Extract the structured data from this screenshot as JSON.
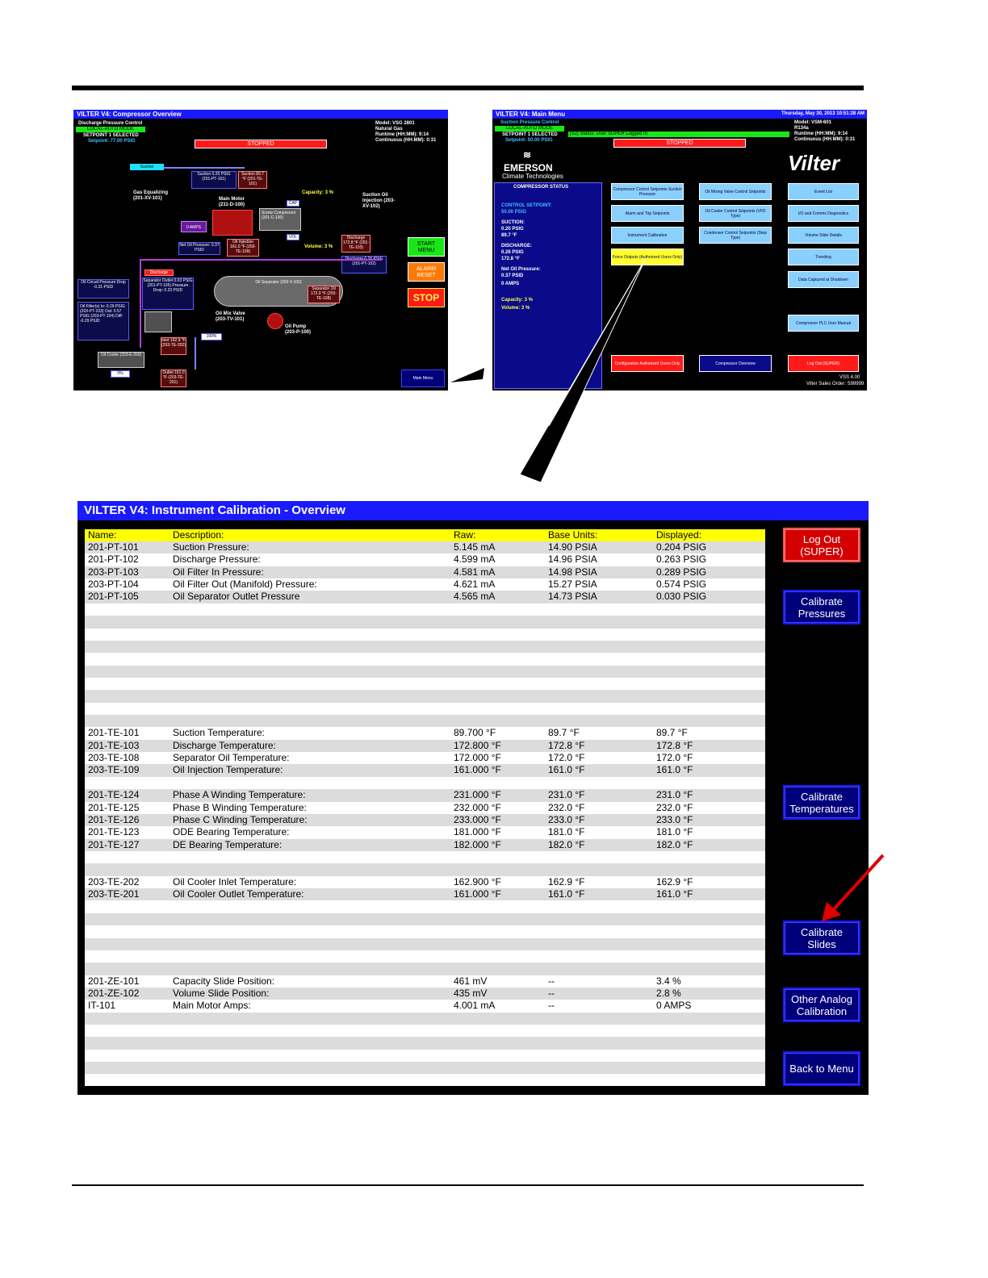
{
  "overview": {
    "title": "VILTER V4: Compressor Overview",
    "mode_title": "Discharge Pressure Control",
    "mode": "LOCAL-AUTO MODE",
    "setpoint_sel": "SETPOINT 1 SELECTED",
    "setpoint": "Setpoint: 77.00 PSIG",
    "model": "Model: VSG 2801",
    "refrigerant": "Natural Gas",
    "runtime": "Runtime (HH:MM): 9:14",
    "continuous": "Continuous (HH:MM): 0:31",
    "status": "STOPPED",
    "suction_label": "Suction",
    "suction_pressure": "Suction 0.20 PSIG (201-PT-101)",
    "suction_temp": "Suction 89.7 °F (201-TE-101)",
    "gas_equalizing": "Gas Equalizing (201-XV-101)",
    "main_motor": "Main Motor (211-D-100)",
    "amps": "0 AMPS",
    "capacity": "Capacity: 3 %",
    "volume": "Volume: 3 %",
    "screw_compressor": "Screw Compressor (201-C-100)",
    "cap": "CAP",
    "vol": "VOL",
    "suction_oil_injection": "Suction Oil Injection (203-XV-102)",
    "net_oil": "Net Oil Pressure: 0.37 PSID",
    "oil_injection": "Oil Injection 161.0 °F (203-TE-109)",
    "discharge_temp": "Discharge 172.8 °F (201-TE-103)",
    "discharge_pressure": "Discharge 0.26 PSIG (201-PT-102)",
    "start_menu": "START MENU",
    "alarm_reset": "ALARM RESET",
    "stop": "STOP",
    "discharge_tag": "Discharge",
    "sep_outlet": "Separator Outlet 0.03 PSIG (201-PT-105) Pressure Drop: 0.23 PSID",
    "oil_separator": "Oil Separator (203-V-100)",
    "sep_oil": "Separator Oil 172.0 °F (203-TE-108)",
    "oil_circuit": "Oil Circuit Pressure Drop -0.31 PSID",
    "oil_filter": "Oil Filter(s) In: 0.29 PSIG (203-PT-103) Out: 0.57 PSIG (203-PT-104) Diff: -0.29 PSID",
    "oil_mix_valve": "Oil Mix Valve (203-TV-101)",
    "oil_pump": "Oil Pump (203-P-100)",
    "pct_100": "100%",
    "inlet": "Inlet 162.9 °F (203-TE-202)",
    "oil_cooler": "Oil Cooler (203-E-200)",
    "pct_0": "0%",
    "outlet": "Outlet 161.0 °F (203-TE-201)",
    "main_menu": "Main Menu"
  },
  "main_menu": {
    "title": "VILTER V4: Main Menu",
    "date": "Thursday, May 30, 2013 10:51:28 AM",
    "mode_title": "Suction Pressure Control",
    "mode": "LOCAL-AUTO MODE",
    "setpoint_sel": "SETPOINT 1 SELECTED",
    "setpoint": "Setpoint: 50.00 PSIG",
    "user_status": "[S2] Status: User SUPER Logged In",
    "status": "STOPPED",
    "model": "Model: VSM-601",
    "refrigerant": "R134a",
    "runtime": "Runtime (HH:MM): 9:14",
    "continuous": "Continuous (HH:MM): 0:31",
    "emerson": "EMERSON",
    "climate": "Climate Technologies",
    "vilter": "Vilter",
    "status_title": "COMPRESSOR STATUS",
    "control_setpoint": "CONTROL SETPOINT:",
    "control_setpoint_val": "50.00 PSIG",
    "suction": "SUCTION:",
    "suction_p": "0.20 PSIG",
    "suction_t": "89.7 °F",
    "discharge": "DISCHARGE:",
    "discharge_p": "0.26 PSIG",
    "discharge_t": "172.8 °F",
    "net_oil": "Net Oil Pressure:",
    "net_oil_val": "0.37 PSID",
    "amps": "0 AMPS",
    "capacity": "Capacity: 3 %",
    "volume": "Volume: 3 %",
    "btn_comp_ctrl": "Compressor Control Setpoints Suction Pressure",
    "btn_alarm": "Alarm and Trip Setpoints",
    "btn_instr": "Instrument Calibration",
    "btn_force": "Force Outputs (Authorized Users Only)",
    "btn_oil_mix": "Oil Mixing Valve Control Setpoints",
    "btn_oil_cooler": "Oil Cooler Control Setpoints (VFD Type)",
    "btn_condenser": "Condenser Control Setpoints (Step Type)",
    "btn_event": "Event List",
    "btn_io": "I/O and Comms Diagnostics",
    "btn_volume": "Volume Slide Details",
    "btn_trending": "Trending",
    "btn_data": "Data Captured at Shutdown",
    "btn_plc": "Compressor PLC User Manual",
    "btn_config": "Configuration Authorized Users Only",
    "btn_overview": "Compressor Overview",
    "btn_logout": "Log Out (SUPER)",
    "version": "VSS 4.00",
    "sales_order": "Vilter Sales Order: S99999"
  },
  "calibration": {
    "title": "VILTER V4: Instrument Calibration - Overview",
    "headers": {
      "name": "Name:",
      "desc": "Description:",
      "raw": "Raw:",
      "base": "Base Units:",
      "disp": "Displayed:"
    },
    "rows": [
      [
        "201-PT-101",
        "Suction Pressure:",
        "5.145 mA",
        "14.90 PSIA",
        "0.204 PSIG"
      ],
      [
        "201-PT-102",
        "Discharge Pressure:",
        "4.599 mA",
        "14.96 PSIA",
        "0.263 PSIG"
      ],
      [
        "203-PT-103",
        "Oil Filter In Pressure:",
        "4.581 mA",
        "14.98 PSIA",
        "0.289 PSIG"
      ],
      [
        "203-PT-104",
        "Oil Filter Out (Manifold) Pressure:",
        "4.621 mA",
        "15.27 PSIA",
        "0.574 PSIG"
      ],
      [
        "201-PT-105",
        "Oil Separator Outlet Pressure",
        "4.565 mA",
        "14.73 PSIA",
        "0.030 PSIG"
      ],
      [
        "",
        "",
        "",
        "",
        ""
      ],
      [
        "",
        "",
        "",
        "",
        ""
      ],
      [
        "",
        "",
        "",
        "",
        ""
      ],
      [
        "",
        "",
        "",
        "",
        ""
      ],
      [
        "",
        "",
        "",
        "",
        ""
      ],
      [
        "",
        "",
        "",
        "",
        ""
      ],
      [
        "",
        "",
        "",
        "",
        ""
      ],
      [
        "",
        "",
        "",
        "",
        ""
      ],
      [
        "",
        "",
        "",
        "",
        ""
      ],
      [
        "",
        "",
        "",
        "",
        ""
      ],
      [
        "201-TE-101",
        "Suction Temperature:",
        "89.700 °F",
        "89.7 °F",
        "89.7 °F"
      ],
      [
        "201-TE-103",
        "Discharge Temperature:",
        "172.800 °F",
        "172.8 °F",
        "172.8 °F"
      ],
      [
        "203-TE-108",
        "Separator Oil Temperature:",
        "172.000 °F",
        "172.0 °F",
        "172.0 °F"
      ],
      [
        "203-TE-109",
        "Oil Injection Temperature:",
        "161.000 °F",
        "161.0 °F",
        "161.0 °F"
      ],
      [
        "",
        "",
        "",
        "",
        ""
      ],
      [
        "201-TE-124",
        "Phase A Winding Temperature:",
        "231.000 °F",
        "231.0 °F",
        "231.0 °F"
      ],
      [
        "201-TE-125",
        "Phase B Winding Temperature:",
        "232.000 °F",
        "232.0 °F",
        "232.0 °F"
      ],
      [
        "201-TE-126",
        "Phase C Winding Temperature:",
        "233.000 °F",
        "233.0 °F",
        "233.0 °F"
      ],
      [
        "201-TE-123",
        "ODE Bearing Temperature:",
        "181.000 °F",
        "181.0 °F",
        "181.0 °F"
      ],
      [
        "201-TE-127",
        "DE Bearing Temperature:",
        "182.000 °F",
        "182.0 °F",
        "182.0 °F"
      ],
      [
        "",
        "",
        "",
        "",
        ""
      ],
      [
        "",
        "",
        "",
        "",
        ""
      ],
      [
        "203-TE-202",
        "Oil Cooler Inlet Temperature:",
        "162.900 °F",
        "162.9 °F",
        "162.9 °F"
      ],
      [
        "203-TE-201",
        "Oil Cooler Outlet Temperature:",
        "161.000 °F",
        "161.0 °F",
        "161.0 °F"
      ],
      [
        "",
        "",
        "",
        "",
        ""
      ],
      [
        "",
        "",
        "",
        "",
        ""
      ],
      [
        "",
        "",
        "",
        "",
        ""
      ],
      [
        "",
        "",
        "",
        "",
        ""
      ],
      [
        "",
        "",
        "",
        "",
        ""
      ],
      [
        "",
        "",
        "",
        "",
        ""
      ],
      [
        "201-ZE-101",
        "Capacity Slide Position:",
        "461 mV",
        "--",
        "3.4 %"
      ],
      [
        "201-ZE-102",
        "Volume Slide Position:",
        "435 mV",
        "--",
        "2.8 %"
      ],
      [
        "IT-101",
        "Main Motor Amps:",
        "4.001 mA",
        "--",
        "0 AMPS"
      ],
      [
        "",
        "",
        "",
        "",
        ""
      ],
      [
        "",
        "",
        "",
        "",
        ""
      ],
      [
        "",
        "",
        "",
        "",
        ""
      ],
      [
        "",
        "",
        "",
        "",
        ""
      ],
      [
        "",
        "",
        "",
        "",
        ""
      ],
      [
        "",
        "",
        "",
        "",
        ""
      ],
      [
        "",
        "",
        "",
        "",
        ""
      ]
    ],
    "buttons": {
      "logout_l1": "Log Out",
      "logout_l2": "(SUPER)",
      "pressures_l1": "Calibrate",
      "pressures_l2": "Pressures",
      "temps_l1": "Calibrate",
      "temps_l2": "Temperatures",
      "slides_l1": "Calibrate",
      "slides_l2": "Slides",
      "analog_l1": "Other Analog",
      "analog_l2": "Calibration",
      "back": "Back to Menu"
    }
  }
}
